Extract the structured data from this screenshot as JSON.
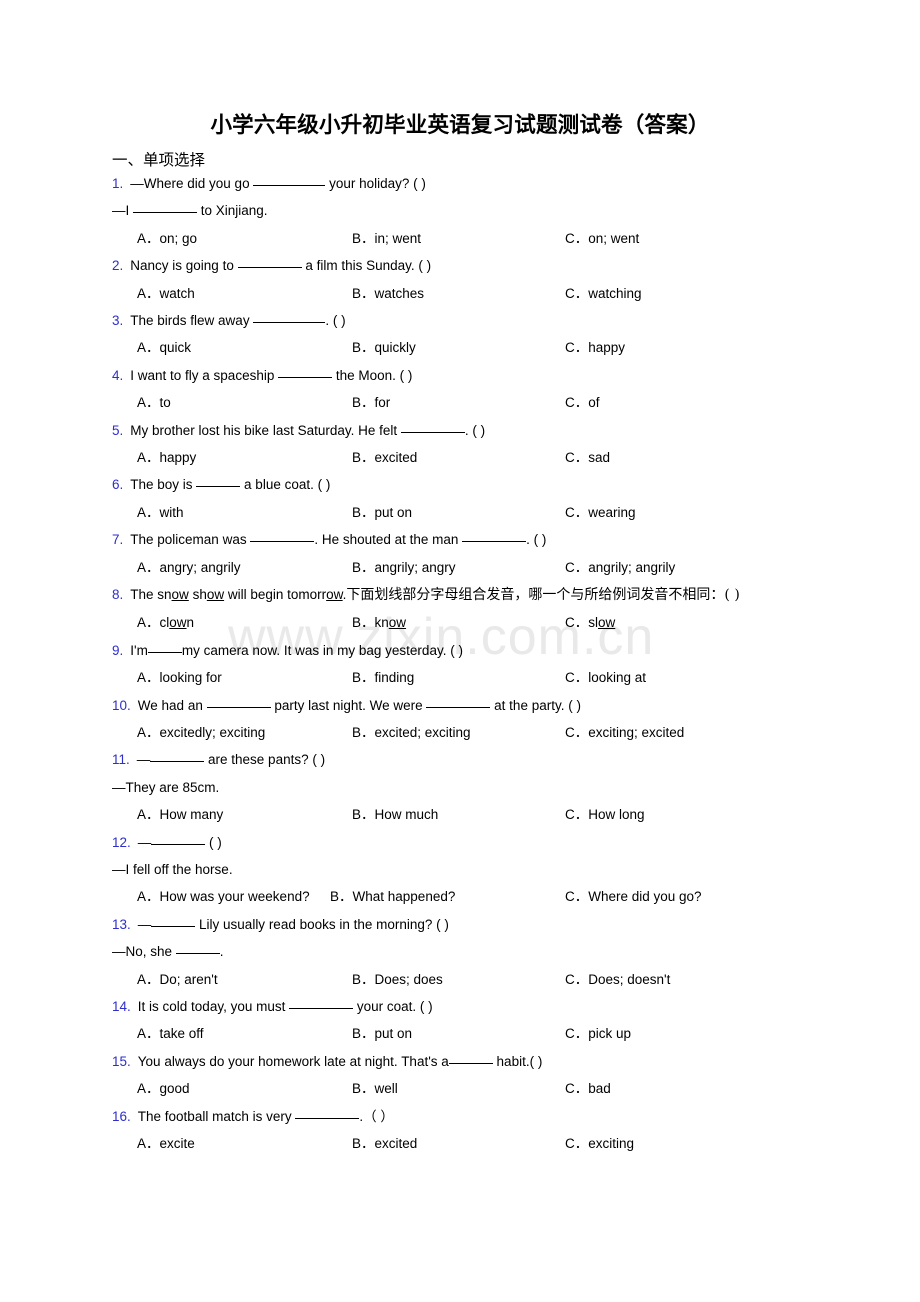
{
  "document": {
    "title": "小学六年级小升初毕业英语复习试题测试卷（答案）",
    "section_heading": "一、单项选择",
    "watermark": "www.zixin.com.cn"
  },
  "questions": [
    {
      "num": "1.",
      "prompt_pre": "—Where did you go ",
      "prompt_post": " your holiday? (    )",
      "second_pre": "—I ",
      "second_post": " to Xinjiang.",
      "options": [
        "A．on; go",
        "B．in; went",
        "C．on; went"
      ],
      "opt_a": "on; go",
      "opt_b": "in; went",
      "opt_c": "on; went"
    },
    {
      "num": "2.",
      "prompt_pre": "Nancy is going to ",
      "prompt_post": " a film this Sunday. (    )",
      "opt_a": "watch",
      "opt_b": "watches",
      "opt_c": "watching"
    },
    {
      "num": "3.",
      "prompt_pre": "The birds flew away ",
      "prompt_post": ". (  )",
      "opt_a": "quick",
      "opt_b": "quickly",
      "opt_c": "happy"
    },
    {
      "num": "4.",
      "prompt_pre": "I want to fly a spaceship ",
      "prompt_post": " the Moon. (    )",
      "opt_a": "to",
      "opt_b": "for",
      "opt_c": "of"
    },
    {
      "num": "5.",
      "prompt_pre": "My brother lost his bike last Saturday. He felt ",
      "prompt_post": ". (  )",
      "opt_a": "happy",
      "opt_b": "excited",
      "opt_c": "sad"
    },
    {
      "num": "6.",
      "prompt_pre": "The boy is ",
      "prompt_post": " a blue coat. (  )",
      "opt_a": "with",
      "opt_b": "put on",
      "opt_c": "wearing"
    },
    {
      "num": "7.",
      "prompt_pre": "The policeman was ",
      "prompt_mid": ". He shouted at the man ",
      "prompt_post": ". (  )",
      "opt_a": "angry; angrily",
      "opt_b": "angrily; angry",
      "opt_c": "angrily; angrily"
    },
    {
      "num": "8.",
      "eng_1": "The sn",
      "ul_1": "ow",
      "eng_2": " sh",
      "ul_2": "ow",
      "eng_3": " will begin tomorr",
      "ul_3": "ow",
      "eng_4": ".",
      "cn_text": "下面划线部分字母组合发音，哪一个与所给例词发音不相同：(  )",
      "opt_a_pre": "cl",
      "opt_a_ul": "ow",
      "opt_a_post": "n",
      "opt_b_pre": "kn",
      "opt_b_ul": "ow",
      "opt_b_post": "",
      "opt_c_pre": "sl",
      "opt_c_ul": "ow",
      "opt_c_post": ""
    },
    {
      "num": "9.",
      "prompt_pre": "I'm",
      "prompt_post": "my camera now. It was in my bag yesterday. (  )",
      "opt_a": "looking for",
      "opt_b": "finding",
      "opt_c": "looking at"
    },
    {
      "num": "10.",
      "prompt_pre": "We had an ",
      "prompt_mid": " party last night. We were ",
      "prompt_post": " at the party. (   )",
      "opt_a": "excitedly; exciting",
      "opt_b": "excited; exciting",
      "opt_c": "exciting; excited"
    },
    {
      "num": "11.",
      "prompt_pre": "—",
      "prompt_post": " are these pants? (    )",
      "second": "—They are 85cm.",
      "opt_a": "How many",
      "opt_b": "How much",
      "opt_c": "How long"
    },
    {
      "num": "12.",
      "prompt_pre": "—",
      "prompt_post": " (  )",
      "second": "—I fell off the horse.",
      "opt_a": "How was your weekend?",
      "opt_b": "What happened?",
      "opt_c": "Where did you go?"
    },
    {
      "num": "13.",
      "prompt_pre": "—",
      "prompt_post": " Lily usually read books in the morning? (   )",
      "second_pre": "—No, she ",
      "second_post": ".",
      "opt_a": "Do; aren't",
      "opt_b": "Does; does",
      "opt_c": "Does; doesn't"
    },
    {
      "num": "14.",
      "prompt_pre": "It is cold today, you must ",
      "prompt_post": " your coat. (  )",
      "opt_a": "take off",
      "opt_b": "put on",
      "opt_c": "pick up"
    },
    {
      "num": "15.",
      "prompt_pre": "You always do your homework late at night. That's a",
      "prompt_post": " habit.(  )",
      "opt_a": "good",
      "opt_b": "well",
      "opt_c": "bad"
    },
    {
      "num": "16.",
      "prompt_pre": "The football match is very ",
      "prompt_post": ".（  ）",
      "opt_a": "excite",
      "opt_b": "excited",
      "opt_c": "exciting"
    }
  ],
  "labels": {
    "a": "A．",
    "b": "B．",
    "c": "C．"
  }
}
